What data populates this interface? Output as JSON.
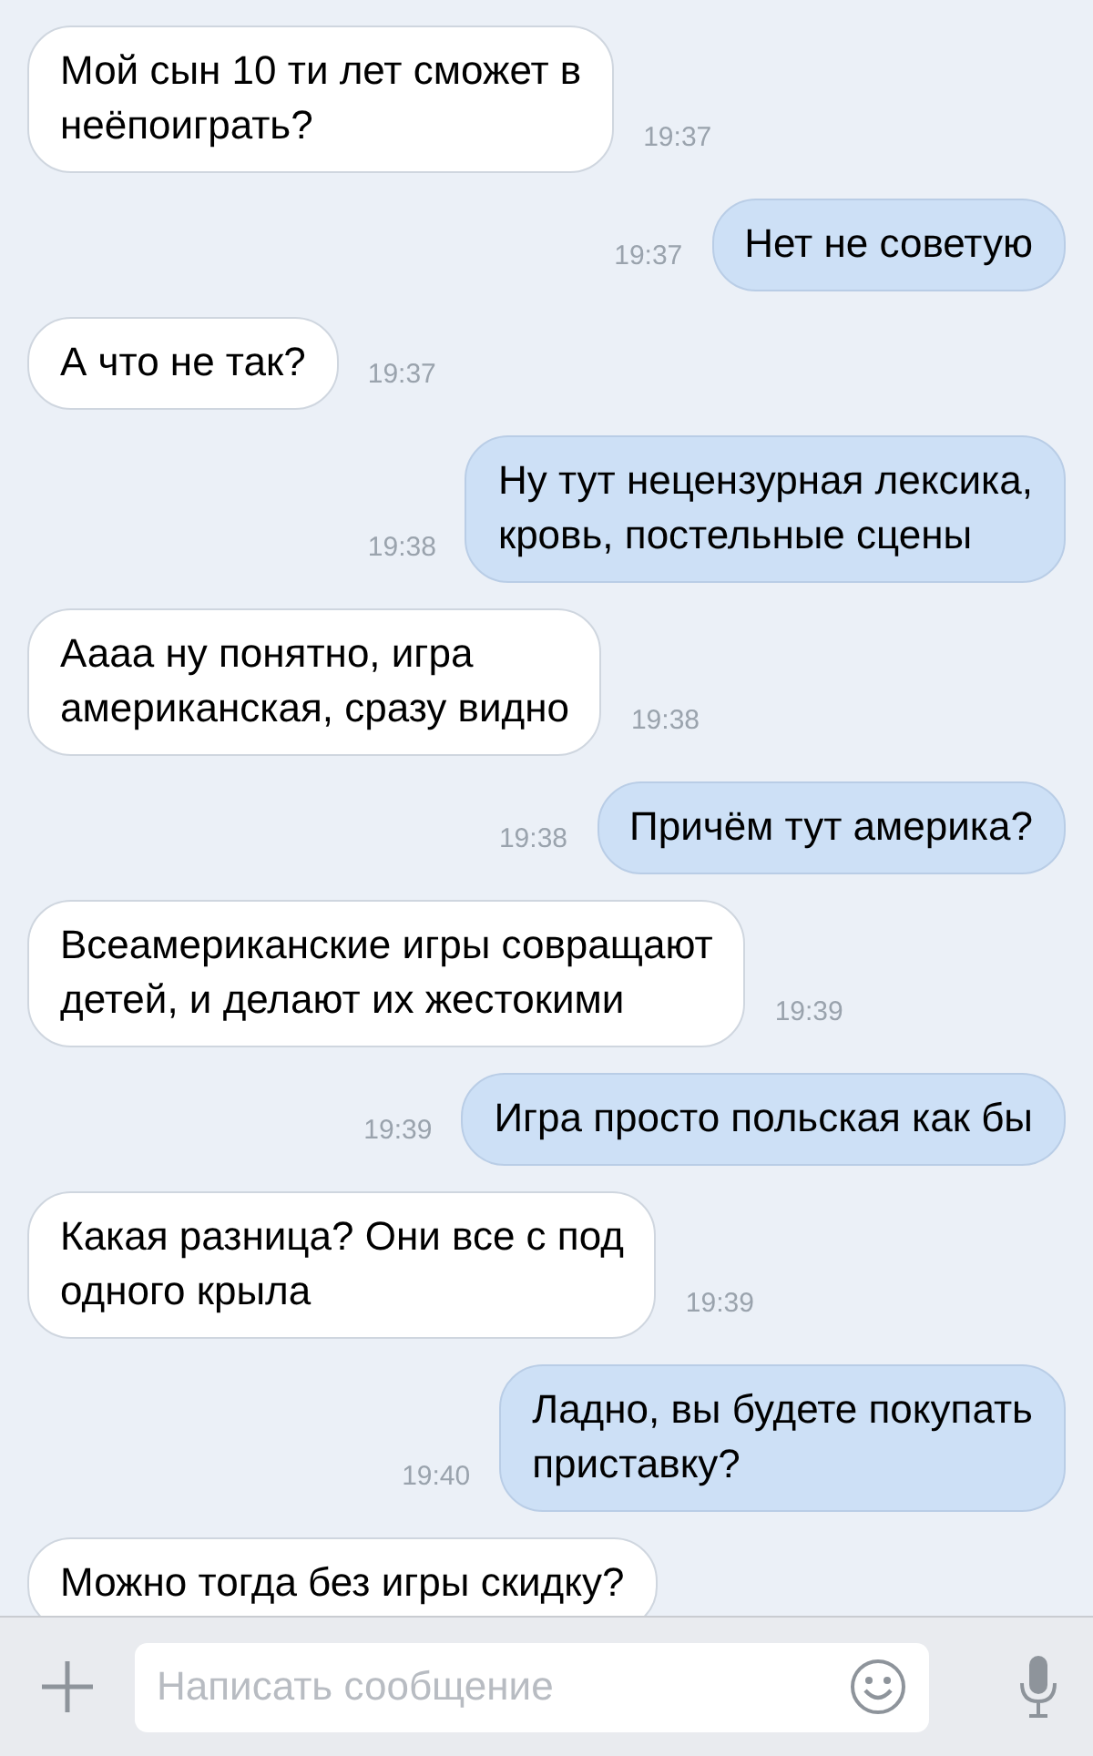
{
  "messages": [
    {
      "outgoing": false,
      "lines": [
        "Мой сын 10 ти лет сможет в",
        "неёпоиграть?"
      ],
      "time": "19:37"
    },
    {
      "outgoing": true,
      "lines": [
        "Нет не советую"
      ],
      "time": "19:37"
    },
    {
      "outgoing": false,
      "lines": [
        "А что не так?"
      ],
      "time": "19:37"
    },
    {
      "outgoing": true,
      "lines": [
        "Ну тут нецензурная лексика,",
        "кровь, постельные сцены"
      ],
      "time": "19:38"
    },
    {
      "outgoing": false,
      "lines": [
        "Аааа ну понятно, игра",
        "американская, сразу видно"
      ],
      "time": "19:38"
    },
    {
      "outgoing": true,
      "lines": [
        "Причём тут америка?"
      ],
      "time": "19:38"
    },
    {
      "outgoing": false,
      "lines": [
        "Всеамериканские игры совращают",
        "детей, и делают их жестокими"
      ],
      "time": "19:39"
    },
    {
      "outgoing": true,
      "lines": [
        "Игра просто польская как бы"
      ],
      "time": "19:39"
    },
    {
      "outgoing": false,
      "lines": [
        "Какая разница? Они все с под",
        "одного крыла"
      ],
      "time": "19:39"
    },
    {
      "outgoing": true,
      "lines": [
        "Ладно, вы будете покупать",
        "приставку?"
      ],
      "time": "19:40"
    },
    {
      "outgoing": false,
      "lines": [
        "Можно тогда без игры скидку?"
      ]
    }
  ],
  "composer": {
    "placeholder": "Написать сообщение"
  }
}
